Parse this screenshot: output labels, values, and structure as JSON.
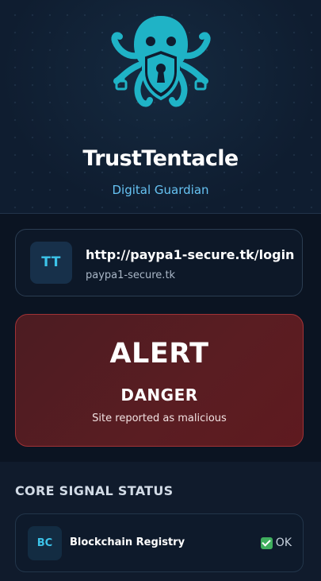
{
  "app": {
    "title": "TrustTentacle",
    "subtitle": "Digital Guardian",
    "logo_icon": "octopus-shield-icon",
    "accent_color": "#1fb3c6"
  },
  "site": {
    "avatar_text": "TT",
    "url": "http://paypa1-secure.tk/login",
    "domain": "paypa1-secure.tk"
  },
  "alert": {
    "title": "ALERT",
    "level": "DANGER",
    "description": "Site reported as malicious",
    "color": "#5a1d22"
  },
  "signals": {
    "title": "CORE SIGNAL STATUS",
    "items": [
      {
        "avatar_text": "BC",
        "label": "Blockchain Registry",
        "status_icon": "check-icon",
        "status": "OK"
      }
    ]
  }
}
